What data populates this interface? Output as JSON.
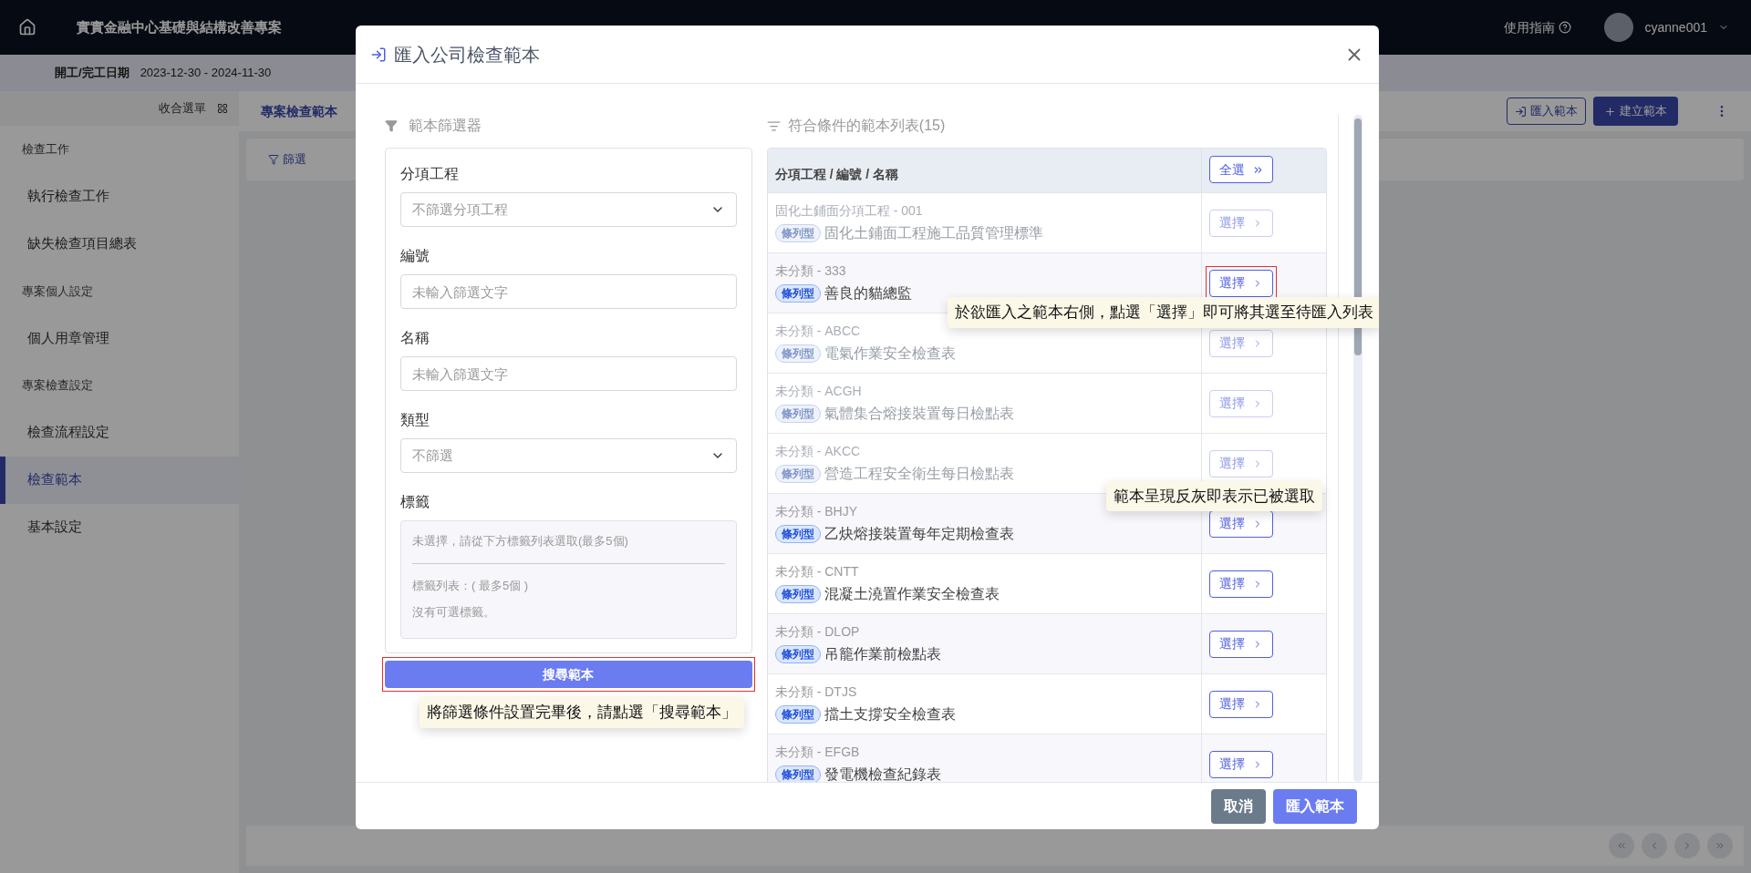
{
  "background": {
    "topbar": {
      "project_title": "實實金融中心基礎與結構改善專案",
      "help_label": "使用指南",
      "username": "cyanne001"
    },
    "subbar": {
      "date_label": "開工/完工日期",
      "date_range": "2023-12-30 - 2024-11-30"
    },
    "sidebar": {
      "collapse_label": "收合選單",
      "sections": [
        {
          "title": "檢查工作",
          "items": [
            {
              "label": "執行檢查工作",
              "selected": false
            },
            {
              "label": "缺失檢查項目總表",
              "selected": false
            }
          ]
        },
        {
          "title": "專案個人設定",
          "items": [
            {
              "label": "個人用章管理",
              "selected": false
            }
          ]
        },
        {
          "title": "專案檢查設定",
          "items": [
            {
              "label": "檢查流程設定",
              "selected": false
            },
            {
              "label": "檢查範本",
              "selected": true
            },
            {
              "label": "基本設定",
              "selected": false
            }
          ]
        }
      ]
    },
    "content": {
      "tab_label": "專案檢查範本",
      "import_button": "匯入範本",
      "create_button": "建立範本",
      "filter_label": "篩選"
    }
  },
  "modal": {
    "title": "匯入公司檢查範本",
    "filter": {
      "heading": "範本篩選器",
      "fields": [
        {
          "kind": "select",
          "label": "分項工程",
          "placeholder": "不篩選分項工程"
        },
        {
          "kind": "text",
          "label": "編號",
          "placeholder": "未輸入篩選文字"
        },
        {
          "kind": "text",
          "label": "名稱",
          "placeholder": "未輸入篩選文字"
        },
        {
          "kind": "select",
          "label": "類型",
          "placeholder": "不篩選"
        },
        {
          "kind": "tags",
          "label": "標籤",
          "hint": "未選擇，請從下方標籤列表選取(最多5個)",
          "list_label": "標籤列表：( 最多5個 )",
          "empty_text": "沒有可選標籤。"
        }
      ],
      "search_button": "搜尋範本",
      "search_highlighted": true,
      "search_callout": "將篩選條件設置完畢後，請點選「搜尋範本」"
    },
    "list": {
      "heading": "符合條件的範本列表(15)",
      "column_header": "分項工程 / 編號 / 名稱",
      "select_all": "全選",
      "rows": [
        {
          "code": "固化土鋪面分項工程 - 001",
          "tag": "條列型",
          "name": "固化土鋪面工程施工品質管理標準",
          "action": "選擇",
          "selected": true,
          "highlighted": false
        },
        {
          "code": "未分類 - 333",
          "tag": "條列型",
          "name": "善良的貓總監",
          "action": "選擇",
          "selected": false,
          "highlighted": true,
          "callout": "於欲匯入之範本右側，點選「選擇」即可將其選至待匯入列表"
        },
        {
          "code": "未分類 - ABCC",
          "tag": "條列型",
          "name": "電氣作業安全檢查表",
          "action": "選擇",
          "selected": true,
          "highlighted": false
        },
        {
          "code": "未分類 - ACGH",
          "tag": "條列型",
          "name": "氣體集合熔接裝置每日檢點表",
          "action": "選擇",
          "selected": true,
          "highlighted": false
        },
        {
          "code": "未分類 - AKCC",
          "tag": "條列型",
          "name": "營造工程安全衛生每日檢點表",
          "action": "選擇",
          "selected": true,
          "highlighted": false,
          "callout": "範本呈現反灰即表示已被選取"
        },
        {
          "code": "未分類 - BHJY",
          "tag": "條列型",
          "name": "乙炔熔接裝置每年定期檢查表",
          "action": "選擇",
          "selected": false,
          "highlighted": false
        },
        {
          "code": "未分類 - CNTT",
          "tag": "條列型",
          "name": "混凝土澆置作業安全檢查表",
          "action": "選擇",
          "selected": false,
          "highlighted": false
        },
        {
          "code": "未分類 - DLOP",
          "tag": "條列型",
          "name": "吊籠作業前檢點表",
          "action": "選擇",
          "selected": false,
          "highlighted": false
        },
        {
          "code": "未分類 - DTJS",
          "tag": "條列型",
          "name": "擋土支撐安全檢查表",
          "action": "選擇",
          "selected": false,
          "highlighted": false
        },
        {
          "code": "未分類 - EFGB",
          "tag": "條列型",
          "name": "發電機檢查紀錄表",
          "action": "選擇",
          "selected": false,
          "highlighted": false
        }
      ]
    },
    "buttons": {
      "cancel": "取消",
      "import": "匯入範本"
    }
  }
}
